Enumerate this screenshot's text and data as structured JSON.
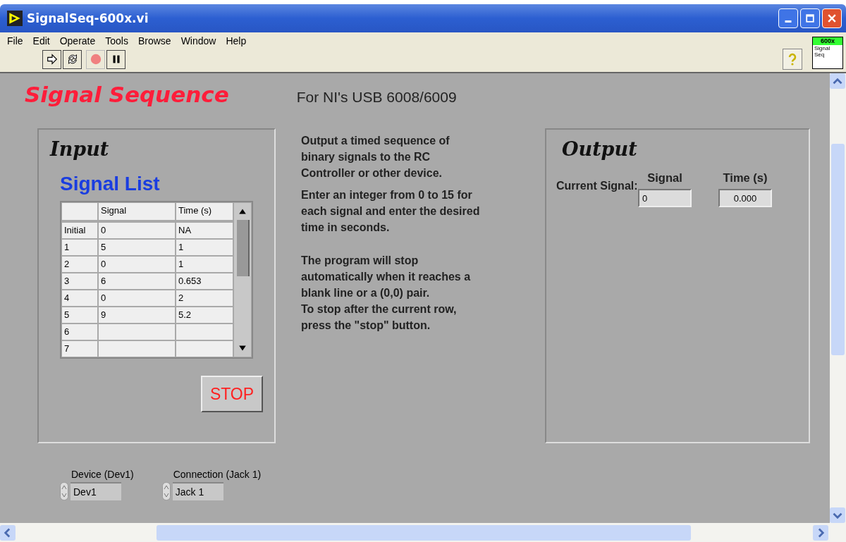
{
  "window": {
    "title": "SignalSeq-600x.vi"
  },
  "menu": [
    "File",
    "Edit",
    "Operate",
    "Tools",
    "Browse",
    "Window",
    "Help"
  ],
  "vi_icon": {
    "badge": "600x",
    "lines": [
      "Signal",
      "Seq"
    ]
  },
  "panel": {
    "title": "Signal Sequence",
    "subtitle": "For NI's USB 6008/6009",
    "input": {
      "title": "Input",
      "table_label": "Signal List",
      "columns": [
        "Signal",
        "Time (s)"
      ],
      "rows": [
        {
          "index": "Initial",
          "signal": "0",
          "time": "NA"
        },
        {
          "index": "1",
          "signal": "5",
          "time": "1"
        },
        {
          "index": "2",
          "signal": "0",
          "time": "1"
        },
        {
          "index": "3",
          "signal": "6",
          "time": "0.653"
        },
        {
          "index": "4",
          "signal": "0",
          "time": "2"
        },
        {
          "index": "5",
          "signal": "9",
          "time": "5.2"
        },
        {
          "index": "6",
          "signal": "",
          "time": ""
        },
        {
          "index": "7",
          "signal": "",
          "time": ""
        }
      ],
      "stop_button": "STOP"
    },
    "instructions": [
      {
        "lines": [
          "Output a timed sequence of binary signals to the RC Controller or other device."
        ]
      },
      {
        "lines": [
          "Enter an integer from 0 to 15 for each signal and enter the desired time in seconds."
        ]
      },
      {
        "lines": [
          "The program will stop automatically when it reaches a blank line or a (0,0) pair.",
          "To stop after the current row, press the \"stop\" button."
        ]
      }
    ],
    "output": {
      "title": "Output",
      "current_label": "Current Signal:",
      "fields": [
        {
          "label": "Signal",
          "value": "0"
        },
        {
          "label": "Time (s)",
          "value": "0.000"
        }
      ]
    },
    "controls": [
      {
        "label": "Device (Dev1)",
        "value": "Dev1"
      },
      {
        "label": "Connection (Jack 1)",
        "value": "Jack 1"
      }
    ]
  }
}
